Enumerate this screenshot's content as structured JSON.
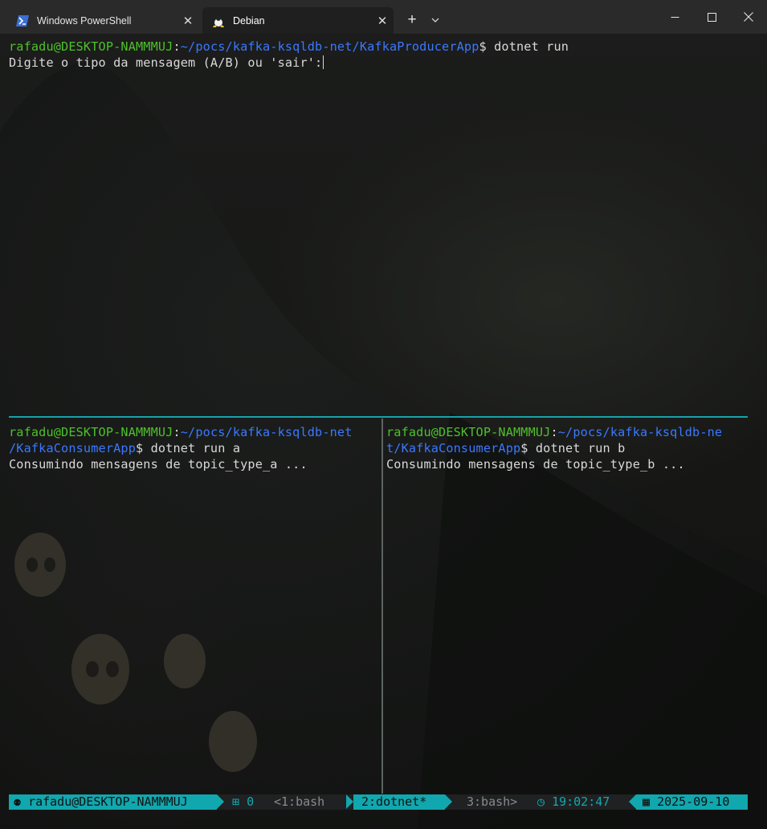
{
  "tabs": [
    {
      "label": "Windows PowerShell",
      "icon": "powershell-icon",
      "active": false
    },
    {
      "label": "Debian",
      "icon": "debian-linux-icon",
      "active": true
    }
  ],
  "titlebar": {
    "new_tab": "+",
    "icons": [
      "plus-icon",
      "chevron-down-icon",
      "minimize-icon",
      "maximize-icon",
      "close-icon"
    ]
  },
  "panes": {
    "top": {
      "user": "rafadu@DESKTOP-NAMMMUJ",
      "sep": ":",
      "path": "~/pocs/kafka-ksqldb-net/KafkaProducerApp",
      "prompt_cmd": "$ dotnet run",
      "output": "Digite o tipo da mensagem (A/B) ou 'sair':"
    },
    "left": {
      "user": "rafadu@DESKTOP-NAMMMUJ",
      "sep": ":",
      "path_line1": "~/pocs/kafka-ksqldb-net",
      "path_line2": "/KafkaConsumerApp",
      "prompt_cmd": "$ dotnet run a",
      "output": "Consumindo mensagens de topic_type_a ..."
    },
    "right": {
      "user": "rafadu@DESKTOP-NAMMMUJ",
      "sep": ":",
      "path_line1": "~/pocs/kafka-ksqldb-ne",
      "path_line2": "t/KafkaConsumerApp",
      "prompt_cmd": "$ dotnet run b",
      "output": "Consumindo mensagens de topic_type_b ..."
    }
  },
  "status_bar": {
    "session_user": "rafadu@DESKTOP-NAMMMUJ",
    "session_id": "0",
    "windows": [
      {
        "label": "<1:bash",
        "current": false
      },
      {
        "label": "2:dotnet*",
        "current": true
      },
      {
        "label": "3:bash>",
        "current": false
      }
    ],
    "time": "19:02:47",
    "date": "2025-09-10",
    "icons": [
      "user-icon",
      "grid-icon",
      "clock-icon",
      "calendar-icon"
    ]
  },
  "colors": {
    "prompt_user": "#4ec02b",
    "prompt_path": "#3b78ff",
    "text": "#d9d9d9",
    "tmux_accent": "#11a7ae",
    "pane_border_active": "#17a2a8"
  }
}
